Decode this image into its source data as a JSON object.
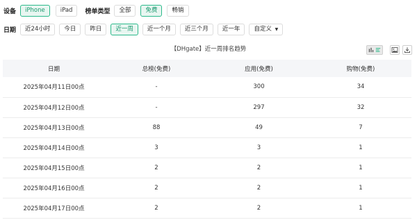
{
  "filters": {
    "device": {
      "label": "设备",
      "options": [
        "iPhone",
        "iPad"
      ],
      "selected": "iPhone"
    },
    "chart_type": {
      "label": "榜单类型",
      "options": [
        "全部",
        "免费",
        "畅销"
      ],
      "selected": "免费"
    },
    "date": {
      "label": "日期",
      "options": [
        "近24小时",
        "今日",
        "昨日",
        "近一周",
        "近一个月",
        "近三个月",
        "近一年"
      ],
      "selected": "近一周",
      "custom_label": "自定义"
    }
  },
  "report_title": "【DHgate】近一周排名趋势",
  "toolbar": {
    "icons": [
      "chart-icon",
      "list-icon",
      "image-icon",
      "download-icon"
    ]
  },
  "table": {
    "headers": [
      "日期",
      "总榜(免费)",
      "应用(免费)",
      "购物(免费)"
    ],
    "rows": [
      [
        "2025年04月11日00点",
        "-",
        "300",
        "34"
      ],
      [
        "2025年04月12日00点",
        "-",
        "297",
        "32"
      ],
      [
        "2025年04月13日00点",
        "88",
        "49",
        "7"
      ],
      [
        "2025年04月14日00点",
        "3",
        "3",
        "1"
      ],
      [
        "2025年04月15日00点",
        "2",
        "2",
        "1"
      ],
      [
        "2025年04月16日00点",
        "2",
        "2",
        "1"
      ],
      [
        "2025年04月17日00点",
        "2",
        "2",
        "1"
      ]
    ]
  },
  "colors": {
    "accent": "#2bb98a",
    "accent_bg": "#e8f6f1",
    "header_bg": "#f5f6f8"
  }
}
